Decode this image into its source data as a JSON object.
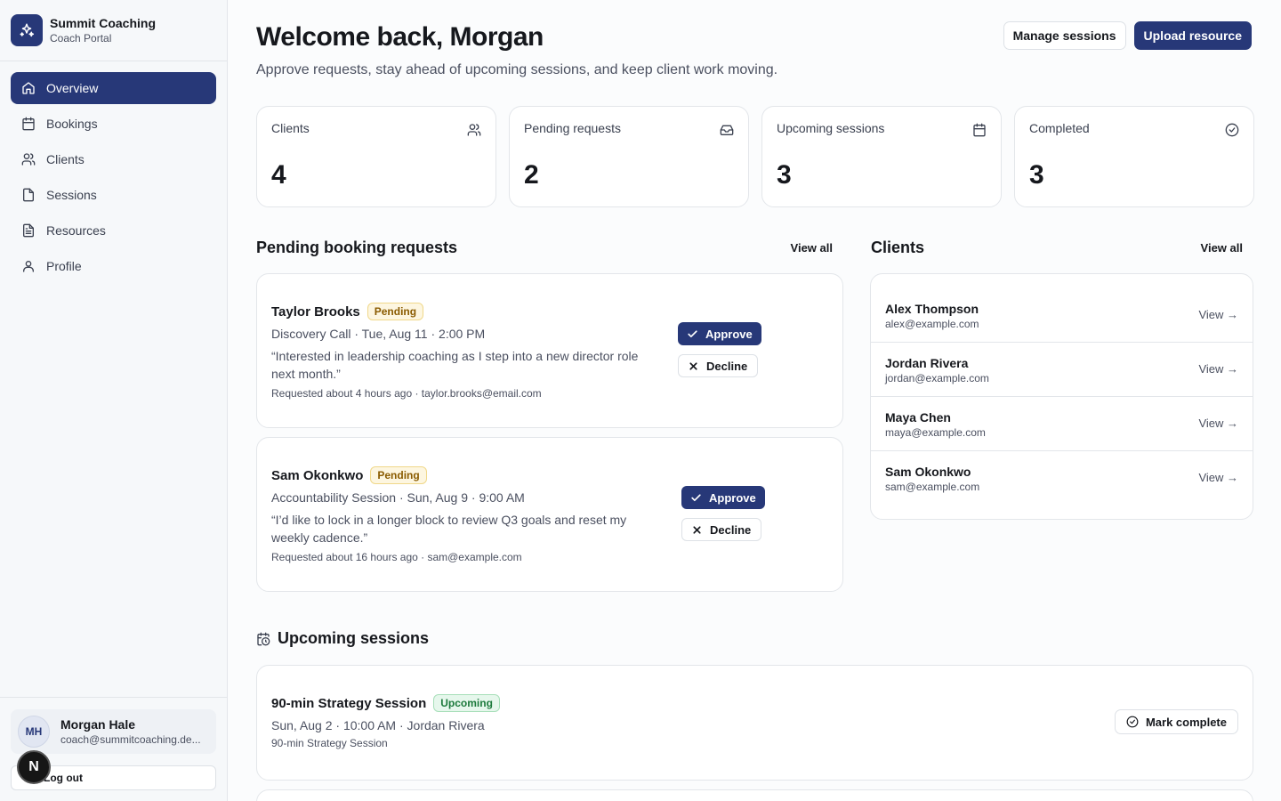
{
  "brand": {
    "title": "Summit Coaching",
    "subtitle": "Coach Portal"
  },
  "nav": [
    {
      "label": "Overview",
      "icon": "home-icon",
      "active": true
    },
    {
      "label": "Bookings",
      "icon": "calendar-icon"
    },
    {
      "label": "Clients",
      "icon": "users-icon"
    },
    {
      "label": "Sessions",
      "icon": "file-icon"
    },
    {
      "label": "Resources",
      "icon": "document-icon"
    },
    {
      "label": "Profile",
      "icon": "user-icon"
    }
  ],
  "user": {
    "initials": "MH",
    "name": "Morgan Hale",
    "email": "coach@summitcoaching.de...",
    "logout_label": "Log out"
  },
  "n_badge": "N",
  "header": {
    "title": "Welcome back, Morgan",
    "subtitle": "Approve requests, stay ahead of upcoming sessions, and keep client work moving.",
    "manage_label": "Manage sessions",
    "upload_label": "Upload resource"
  },
  "stats": [
    {
      "label": "Clients",
      "value": "4",
      "icon": "users-icon"
    },
    {
      "label": "Pending requests",
      "value": "2",
      "icon": "inbox-icon"
    },
    {
      "label": "Upcoming sessions",
      "value": "3",
      "icon": "calendar-icon"
    },
    {
      "label": "Completed",
      "value": "3",
      "icon": "check-circle-icon"
    }
  ],
  "pending": {
    "title": "Pending booking requests",
    "view_all": "View all",
    "requests": [
      {
        "name": "Taylor Brooks",
        "status": "Pending",
        "detail": "Discovery Call · Tue, Aug 11 · 2:00 PM",
        "quote": "“Interested in leadership coaching as I step into a new director role next month.”",
        "meta": "Requested about 4 hours ago · taylor.brooks@email.com",
        "approve": "Approve",
        "decline": "Decline"
      },
      {
        "name": "Sam Okonkwo",
        "status": "Pending",
        "detail": "Accountability Session · Sun, Aug 9 · 9:00 AM",
        "quote": "“I’d like to lock in a longer block to review Q3 goals and reset my weekly cadence.”",
        "meta": "Requested about 16 hours ago · sam@example.com",
        "approve": "Approve",
        "decline": "Decline"
      }
    ]
  },
  "clients": {
    "title": "Clients",
    "view_all": "View all",
    "view_label": "View →",
    "list": [
      {
        "name": "Alex Thompson",
        "email": "alex@example.com"
      },
      {
        "name": "Jordan Rivera",
        "email": "jordan@example.com"
      },
      {
        "name": "Maya Chen",
        "email": "maya@example.com"
      },
      {
        "name": "Sam Okonkwo",
        "email": "sam@example.com"
      }
    ]
  },
  "upcoming": {
    "title": "Upcoming sessions",
    "sessions": [
      {
        "title": "90-min Strategy Session",
        "status": "Upcoming",
        "detail": "Sun, Aug 2 · 10:00 AM · Jordan Rivera",
        "meta": "90-min Strategy Session",
        "action": "Mark complete"
      }
    ]
  },
  "colors": {
    "accent": "#273878",
    "pending_badge": "#fdf6e0",
    "upcoming_badge": "#e6f7ec"
  }
}
